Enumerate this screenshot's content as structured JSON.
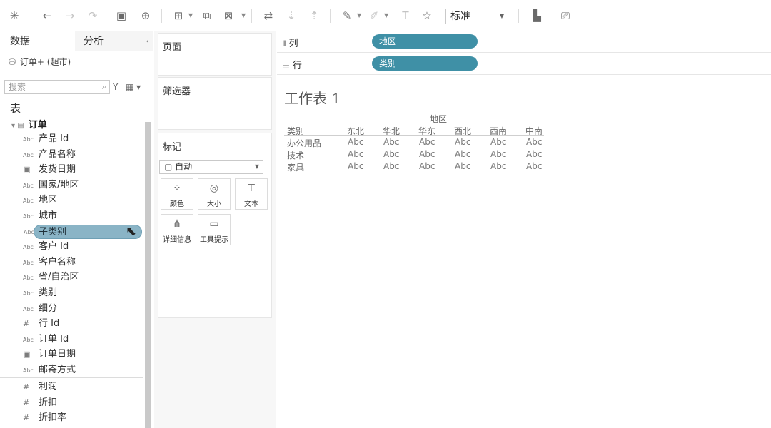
{
  "toolbar": {
    "fit_value": "标准"
  },
  "data_pane": {
    "tab_data": "数据",
    "tab_analysis": "分析",
    "datasource": "订单+ (超市)",
    "search_placeholder": "搜索",
    "tables_header": "表",
    "table_name": "订单",
    "fields": [
      {
        "type": "Abc",
        "label": "产品 Id"
      },
      {
        "type": "Abc",
        "label": "产品名称"
      },
      {
        "type": "date",
        "label": "发货日期"
      },
      {
        "type": "Abc",
        "label": "国家/地区"
      },
      {
        "type": "Abc",
        "label": "地区"
      },
      {
        "type": "Abc",
        "label": "城市"
      },
      {
        "type": "Abc",
        "label": "子类别"
      },
      {
        "type": "Abc",
        "label": "客户 Id"
      },
      {
        "type": "Abc",
        "label": "客户名称"
      },
      {
        "type": "Abc",
        "label": "省/自治区"
      },
      {
        "type": "Abc",
        "label": "类别"
      },
      {
        "type": "Abc",
        "label": "细分"
      },
      {
        "type": "#",
        "label": "行 Id"
      },
      {
        "type": "Abc",
        "label": "订单 Id"
      },
      {
        "type": "date",
        "label": "订单日期"
      },
      {
        "type": "Abc",
        "label": "邮寄方式"
      }
    ],
    "measures": [
      {
        "type": "#",
        "label": "利润"
      },
      {
        "type": "#",
        "label": "折扣"
      },
      {
        "type": "#",
        "label": "折扣率"
      }
    ]
  },
  "shelves": {
    "pages_label": "页面",
    "filters_label": "筛选器",
    "marks_label": "标记",
    "marks_type": "自动",
    "mark_buttons": [
      "颜色",
      "大小",
      "文本",
      "详细信息",
      "工具提示"
    ],
    "columns_label": "列",
    "rows_label": "行",
    "columns_pill": "地区",
    "rows_pill": "类别"
  },
  "view": {
    "sheet_title": "工作表 1",
    "column_header_title": "地区",
    "row_header_title": "类别",
    "regions": [
      "东北",
      "华北",
      "华东",
      "西北",
      "西南",
      "中南"
    ],
    "categories": [
      "办公用品",
      "技术",
      "家具"
    ],
    "cell_value": "Abc"
  }
}
